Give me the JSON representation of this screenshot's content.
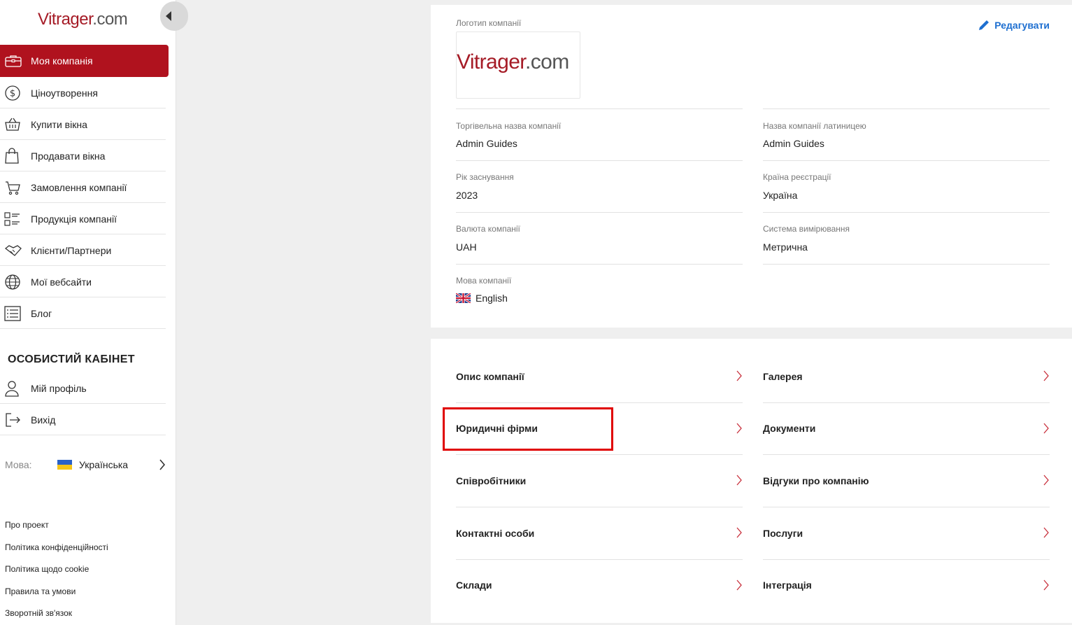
{
  "app": {
    "logo_brand": "Vitrager",
    "logo_tld": ".com"
  },
  "sidebar": {
    "items": [
      {
        "label": "Моя компанія",
        "icon": "briefcase-icon",
        "active": true
      },
      {
        "label": "Ціноутворення",
        "icon": "dollar-circle-icon"
      },
      {
        "label": "Купити вікна",
        "icon": "basket-icon"
      },
      {
        "label": "Продавати вікна",
        "icon": "shopping-bag-icon"
      },
      {
        "label": "Замовлення компанії",
        "icon": "cart-icon"
      },
      {
        "label": "Продукція компанії",
        "icon": "product-list-icon"
      },
      {
        "label": "Клієнти/Партнери",
        "icon": "handshake-icon"
      },
      {
        "label": "Мої вебсайти",
        "icon": "globe-icon"
      },
      {
        "label": "Блог",
        "icon": "blog-list-icon"
      }
    ],
    "section_title": "ОСОБИСТИЙ КАБІНЕТ",
    "personal": [
      {
        "label": "Мій профіль",
        "icon": "user-icon"
      },
      {
        "label": "Вихід",
        "icon": "logout-icon"
      }
    ],
    "language": {
      "label": "Мова:",
      "value": "Українська"
    },
    "footer_links": [
      "Про проект",
      "Політика конфіденційності",
      "Політика щодо cookie",
      "Правила та умови",
      "Зворотній зв'язок"
    ]
  },
  "company": {
    "edit_label": "Редагувати",
    "logo_label": "Логотип компанії",
    "fields": {
      "trade_name_label": "Торгівельна назва компанії",
      "trade_name_value": "Admin Guides",
      "latin_name_label": "Назва компанії латиницею",
      "latin_name_value": "Admin Guides",
      "year_label": "Рік заснування",
      "year_value": "2023",
      "country_label": "Країна реєстрації",
      "country_value": "Україна",
      "currency_label": "Валюта компанії",
      "currency_value": "UAH",
      "measure_label": "Система вимірювання",
      "measure_value": "Метрична",
      "language_label": "Мова компанії",
      "language_value": "English"
    }
  },
  "sections": {
    "left": [
      "Опис компанії",
      "Юридичні фірми",
      "Співробітники",
      "Контактні особи",
      "Склади"
    ],
    "right": [
      "Галерея",
      "Документи",
      "Відгуки про компанію",
      "Послуги",
      "Інтеграція"
    ]
  },
  "colors": {
    "brand": "#a51b26",
    "active_bg": "#b0121e",
    "link_blue": "#1e6fd0",
    "chevron": "#c8303c",
    "highlight": "#e00000"
  }
}
